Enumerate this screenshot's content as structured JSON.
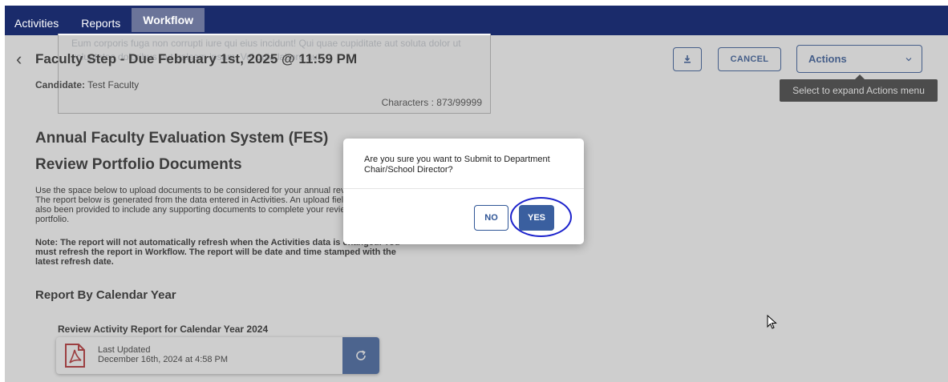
{
  "nav": {
    "tabs": [
      {
        "label": "Activities"
      },
      {
        "label": "Reports"
      },
      {
        "label": "Workflow"
      }
    ]
  },
  "header": {
    "back_icon": "chevron-left-icon",
    "title": "Faculty Step - Due February 1st, 2025 @ 11:59 PM",
    "candidate_label": "Candidate:",
    "candidate_value": "Test Faculty"
  },
  "background_editor": {
    "ghost_text": "Eum corporis fuga non corrupti iure qui eius incidunt! Qui quae cupiditate aut soluta dolor ut voluptates doloribus aut galsam ipsam. Vel quia labore aut",
    "characters": "Characters : 873/99999"
  },
  "toolbar": {
    "download_icon": "download-icon",
    "cancel_label": "CANCEL",
    "actions_label": "Actions",
    "actions_icon": "chevron-down-icon",
    "tooltip": "Select to expand Actions menu"
  },
  "content": {
    "heading": "Annual Faculty Evaluation System (FES)",
    "subheading": "Review Portfolio Documents",
    "description": "Use the space below to upload documents to be considered for your annual review. The report below is generated from the data entered in Activities. An upload field has also been provided to include any supporting documents to complete your review portfolio.",
    "note": "Note: The report will not automatically refresh when the Activities data is changed. You must refresh the report in Workflow. The report will be date and time stamped with the latest refresh date.",
    "report_heading": "Report By Calendar Year",
    "report_label": "Review Activity Report for Calendar Year 2024",
    "file_status": "Last Updated",
    "file_date": "December 16th, 2024 at 4:58 PM",
    "file_icon": "pdf-icon",
    "refresh_icon": "refresh-icon"
  },
  "modal": {
    "message": "Are you sure you want to Submit to Department Chair/School Director?",
    "no_label": "NO",
    "yes_label": "YES"
  },
  "colors": {
    "nav_bg": "#1a2b6b",
    "accent": "#2f5596",
    "primary_button": "#3a5f9f",
    "annotation": "#1c22cc"
  }
}
